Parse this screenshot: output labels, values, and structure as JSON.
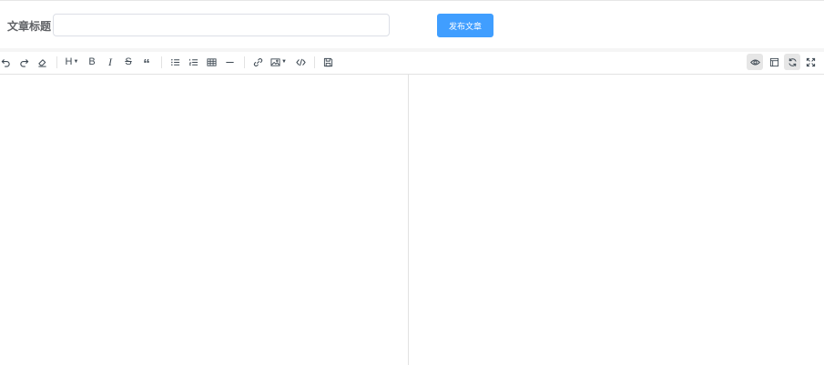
{
  "header": {
    "title_label": "文章标题",
    "title_value": "",
    "title_placeholder": "",
    "publish_label": "发布文章",
    "publish_color": "#409eff"
  },
  "toolbar": {
    "left_tools": [
      "undo-icon",
      "redo-icon",
      "clear-icon",
      "heading-icon",
      "bold-icon",
      "italic-icon",
      "strikethrough-icon",
      "quote-icon",
      "unordered-list-icon",
      "ordered-list-icon",
      "table-icon",
      "horizontal-rule-icon",
      "link-icon",
      "image-icon",
      "code-icon",
      "save-icon"
    ],
    "right_tools": [
      "preview-icon",
      "html-preview-icon",
      "sync-scroll-icon",
      "fullscreen-icon"
    ],
    "heading_text": "H",
    "bold_text": "B",
    "italic_text": "I",
    "strike_text": "S",
    "quote_text": "“"
  },
  "editor": {
    "content": ""
  },
  "preview": {
    "content": ""
  }
}
